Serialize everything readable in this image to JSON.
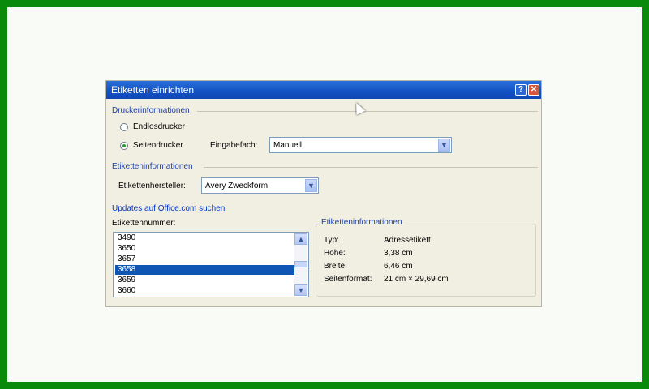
{
  "dialog": {
    "title": "Etiketten einrichten",
    "help_button": "?",
    "close_button": "✕"
  },
  "printer": {
    "section_title": "Druckerinformationen",
    "radio_continuous": "Endlosdrucker",
    "radio_page": "Seitendrucker",
    "selected": "Seitendrucker",
    "tray_label": "Eingabefach:",
    "tray_value": "Manuell"
  },
  "label_info": {
    "section_title": "Etiketteninformationen",
    "manufacturer_label": "Etikettenhersteller:",
    "manufacturer_value": "Avery Zweckform",
    "updates_link": "Updates auf Office.com suchen",
    "number_label": "Etikettennummer:",
    "numbers": [
      "3490",
      "3650",
      "3657",
      "3658",
      "3659",
      "3660"
    ],
    "selected_number": "3658"
  },
  "details": {
    "group_title": "Etiketteninformationen",
    "rows": [
      {
        "key": "Typ:",
        "value": "Adressetikett"
      },
      {
        "key": "Höhe:",
        "value": "3,38 cm"
      },
      {
        "key": "Breite:",
        "value": "6,46 cm"
      },
      {
        "key": "Seitenformat:",
        "value": "21 cm × 29,69 cm"
      }
    ]
  },
  "colors": {
    "frame": "#0a8a0a",
    "titlebar": "#1453c4",
    "selection": "#0f56b4",
    "section_text": "#1f3fa8"
  }
}
